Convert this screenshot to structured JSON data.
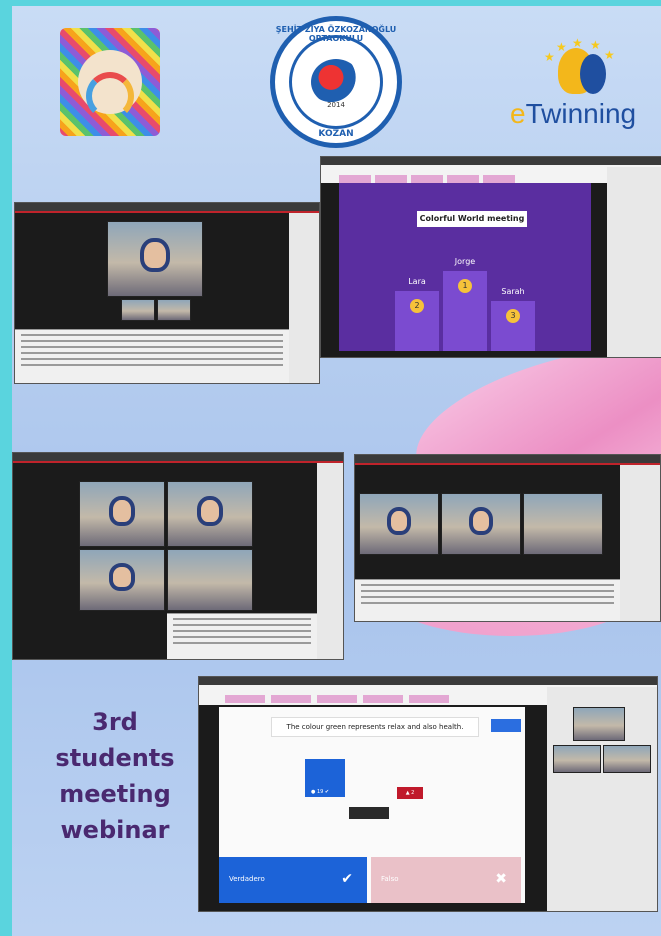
{
  "logos": {
    "school": {
      "top_text": "ŞEHİT ZİYA ÖZKOZANOĞLU ORTAOKULU",
      "year": "2014",
      "bottom_text": "KOZAN"
    },
    "etwinning": {
      "prefix": "e",
      "rest": "Twinning"
    }
  },
  "screenshots": {
    "podium": {
      "title": "Colorful World meeting",
      "players": [
        {
          "name": "Lara",
          "rank": "2"
        },
        {
          "name": "Jorge",
          "rank": "1"
        },
        {
          "name": "Sarah",
          "rank": "3"
        }
      ]
    },
    "quiz": {
      "question": "The colour green represents relax and also health.",
      "answers": [
        {
          "label": "Verdadero",
          "mark": "✔"
        },
        {
          "label": "Falso",
          "mark": "✖"
        }
      ]
    }
  },
  "heading": {
    "line1": "3rd",
    "line2": "students",
    "line3": "meeting",
    "line4": "webinar"
  },
  "colors": {
    "border": "#5ad4de",
    "background": "#b8cff0",
    "heading": "#4a2970",
    "accent_blue": "#1f5fb0",
    "etwinning_yellow": "#f3b71b"
  }
}
